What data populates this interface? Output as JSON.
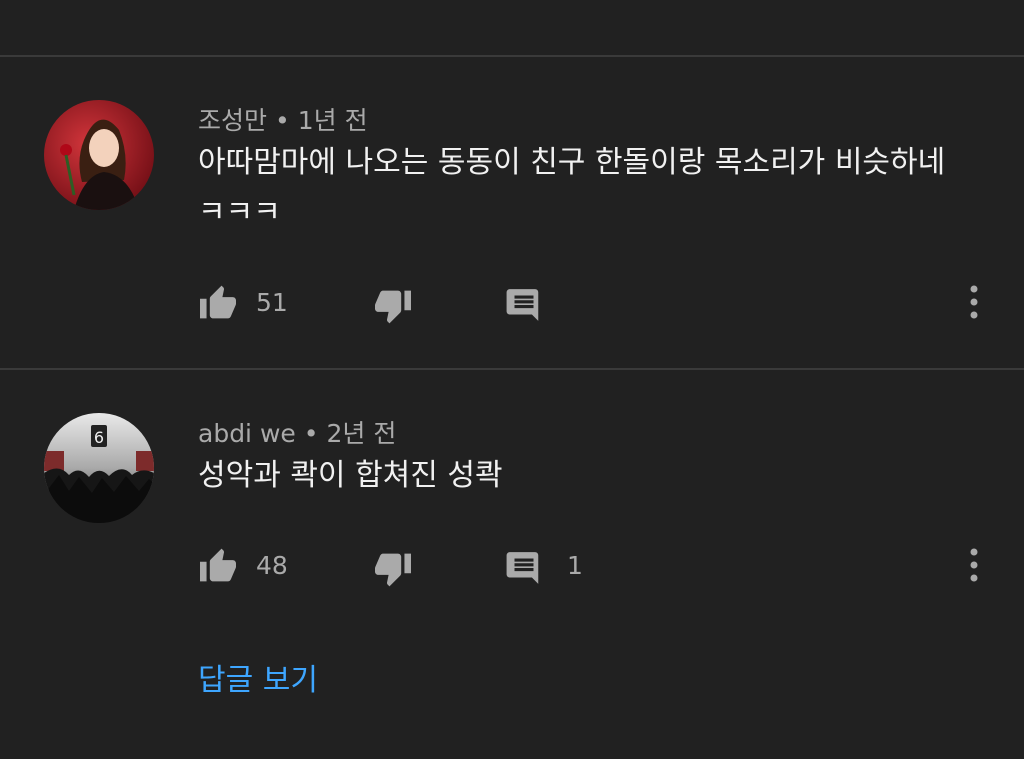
{
  "comments": [
    {
      "author": "조성만",
      "separator": "•",
      "time": "1년 전",
      "text": "아따맘마에 나오는 동동이 친구 한돌이랑 목소리가 비슷하네 ㅋㅋㅋ",
      "likes": "51",
      "replies": ""
    },
    {
      "author": "abdi we",
      "separator": "•",
      "time": "2년 전",
      "text": "성악과 콱이 합쳐진 성콱",
      "likes": "48",
      "replies": "1"
    }
  ],
  "view_replies": "답글 보기",
  "icons": {
    "like": "thumbs-up-icon",
    "dislike": "thumbs-down-icon",
    "reply": "comment-icon",
    "more": "more-vertical-icon"
  },
  "colors": {
    "background": "#212121",
    "link": "#3ea6ff",
    "secondary_text": "#aaaaaa"
  }
}
